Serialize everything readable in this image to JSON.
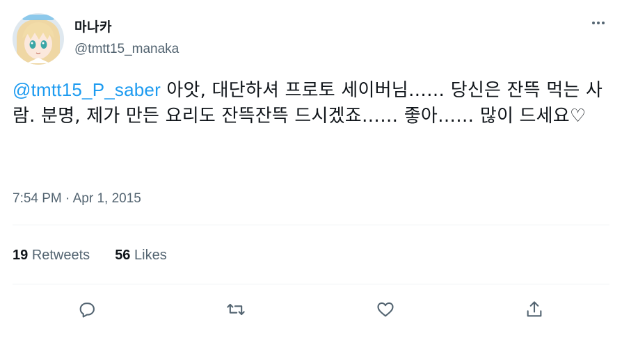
{
  "user": {
    "display_name": "마나카",
    "handle": "@tmtt15_manaka",
    "avatar_icon": "anime-avatar"
  },
  "tweet": {
    "mention": "@tmtt15_P_saber",
    "text": " 아앗, 대단하셔 프로토 세이버님…… 당신은 잔뜩 먹는 사람. 분명, 제가 만든 요리도 잔뜩잔뜩 드시겠죠…… 좋아…… 많이 드세요♡",
    "timestamp": "7:54 PM · Apr 1, 2015"
  },
  "stats": {
    "retweets_count": "19",
    "retweets_label": "Retweets",
    "likes_count": "56",
    "likes_label": "Likes"
  },
  "actions": {
    "icons": [
      "reply-icon",
      "retweet-icon",
      "like-icon",
      "share-icon"
    ]
  },
  "colors": {
    "accent": "#1d9bf0",
    "text": "#0f1419",
    "secondary": "#536471",
    "divider": "#eff3f4"
  }
}
